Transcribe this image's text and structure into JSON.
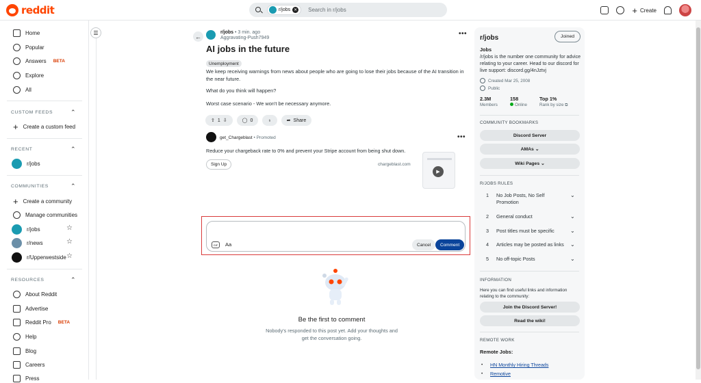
{
  "header": {
    "logo_text": "reddit",
    "search_chip": "r/jobs",
    "search_placeholder": "Search in r/jobs",
    "create_label": "Create"
  },
  "sidebar": {
    "nav": [
      {
        "label": "Home",
        "icon": "home-icon"
      },
      {
        "label": "Popular",
        "icon": "popular-icon"
      },
      {
        "label": "Answers",
        "icon": "answers-icon",
        "badge": "BETA"
      },
      {
        "label": "Explore",
        "icon": "explore-icon"
      },
      {
        "label": "All",
        "icon": "all-icon"
      }
    ],
    "custom_feeds_title": "CUSTOM FEEDS",
    "create_custom_feed": "Create a custom feed",
    "recent_title": "RECENT",
    "recent": [
      {
        "label": "r/jobs"
      }
    ],
    "communities_title": "COMMUNITIES",
    "create_community": "Create a community",
    "manage_communities": "Manage communities",
    "communities": [
      {
        "label": "r/jobs",
        "color": "#1a9bb1"
      },
      {
        "label": "r/news",
        "color": "#6b8fa8"
      },
      {
        "label": "r/Upperwestside",
        "color": "#111111"
      }
    ],
    "resources_title": "RESOURCES",
    "resources": [
      {
        "label": "About Reddit"
      },
      {
        "label": "Advertise"
      },
      {
        "label": "Reddit Pro",
        "badge": "BETA"
      },
      {
        "label": "Help"
      },
      {
        "label": "Blog"
      },
      {
        "label": "Careers"
      },
      {
        "label": "Press"
      }
    ]
  },
  "post": {
    "subreddit": "r/jobs",
    "time": "• 3 min. ago",
    "author": "Aggravating-Push7949",
    "title": "AI jobs in the future",
    "flair": "Unemployment",
    "body": [
      "We keep receiving warnings from news about people who are going to lose their jobs because of the AI transition in the near future.",
      "What do you think will happen?",
      "Worst case scenario - We won't be necessary anymore."
    ],
    "votes": "1",
    "comments": "0",
    "share_label": "Share"
  },
  "promo": {
    "author": "get_Chargeblast",
    "promoted": "• Promoted",
    "text": "Reduce your chargeback rate to 0% and prevent your Stripe account from being shut down.",
    "cta": "Sign Up",
    "domain": "chargeblast.com"
  },
  "comment_box": {
    "format_label": "Aa",
    "gif_label": "GIF",
    "cancel_label": "Cancel",
    "comment_label": "Comment"
  },
  "empty_state": {
    "title": "Be the first to comment",
    "subtitle": "Nobody's responded to this post yet. Add your thoughts and get the conversation going."
  },
  "right_panel": {
    "title": "r/jobs",
    "joined_label": "Joined",
    "heading": "Jobs",
    "description": "/r/jobs is the number one community for advice relating to your career. Head to our discord for live support: discord.gg/4nJztvj",
    "created": "Created Mar 25, 2008",
    "visibility": "Public",
    "stats": [
      {
        "value": "2.3M",
        "label": "Members"
      },
      {
        "value": "158",
        "label": "Online"
      },
      {
        "value": "Top 1%",
        "label": "Rank by size"
      }
    ],
    "bookmarks_title": "COMMUNITY BOOKMARKS",
    "bookmarks": [
      "Discord Server",
      "AMAs",
      "Wiki Pages"
    ],
    "rules_title": "R/JOBS RULES",
    "rules": [
      {
        "num": "1",
        "text": "No Job Posts, No Self Promotion"
      },
      {
        "num": "2",
        "text": "General conduct"
      },
      {
        "num": "3",
        "text": "Post titles must be specific"
      },
      {
        "num": "4",
        "text": "Articles may be posted as links"
      },
      {
        "num": "5",
        "text": "No off-topic Posts"
      }
    ],
    "info_title": "INFORMATION",
    "info_text": "Here you can find useful links and information relating to the community:",
    "info_buttons": [
      "Join the Discord Server!",
      "Read the wiki!"
    ],
    "remote_title": "REMOTE WORK",
    "remote_heading": "Remote Jobs:",
    "remote_links": [
      "HN Monthly Hiring Threads",
      "Remotive"
    ]
  }
}
